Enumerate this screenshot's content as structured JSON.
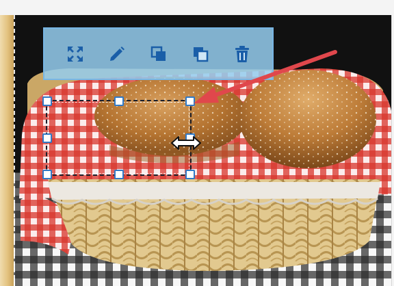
{
  "toolbar": {
    "tools": [
      {
        "id": "fullscreen",
        "icon": "expand-icon"
      },
      {
        "id": "edit",
        "icon": "pencil-icon"
      },
      {
        "id": "bring-forward",
        "icon": "layers-front-icon"
      },
      {
        "id": "send-backward",
        "icon": "layers-back-icon"
      },
      {
        "id": "delete",
        "icon": "trash-icon"
      }
    ]
  },
  "selection": {
    "state": "selected"
  },
  "colors": {
    "toolbar_fill": "#94ccee",
    "toolbar_border": "#78b6e4",
    "icon": "#1a5ea8",
    "handle_border": "#3079c6",
    "arrow": "#e0474c"
  }
}
